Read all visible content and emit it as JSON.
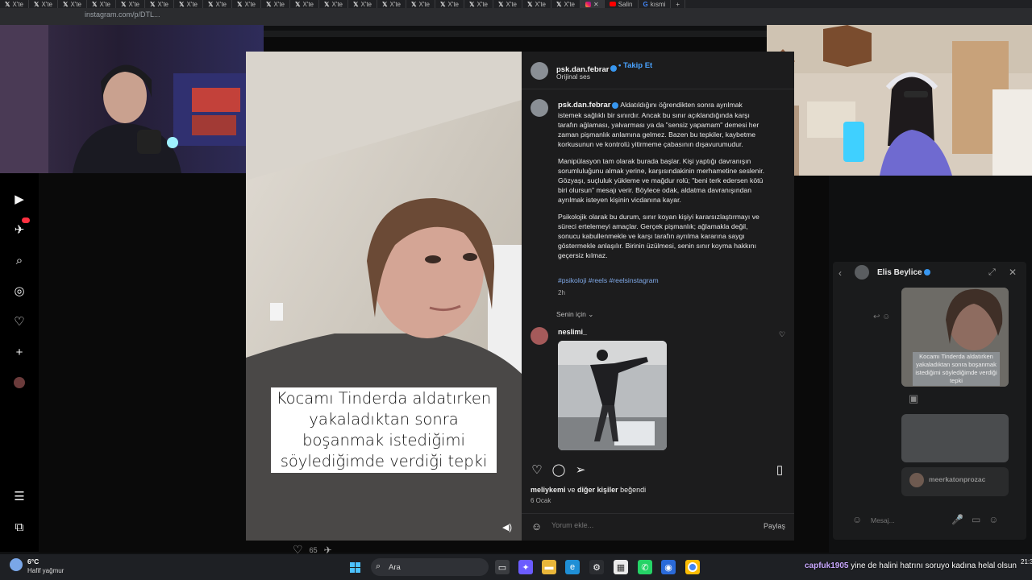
{
  "browser": {
    "tabs": [
      "X'te",
      "X'te",
      "X'te",
      "X'te",
      "X'te",
      "X'te",
      "X'te",
      "X'te",
      "X'te",
      "X'te",
      "X'te",
      "X'te",
      "X'te",
      "X'te",
      "X'te",
      "X'te",
      "X'te",
      "X'te",
      "X'te",
      "X'te",
      "Salin",
      "kısmi"
    ],
    "url": "instagram.com/p/DTL..."
  },
  "post": {
    "author": "psk.dan.febrar",
    "follow_label": "Takip Et",
    "audio": "Orijinal ses",
    "caption_author": "psk.dan.febrar",
    "caption_p1": "Aldatıldığını öğrendikten sonra ayrılmak istemek sağlıklı bir sınırdır. Ancak bu sınır açıklandığında karşı tarafın ağlaması, yalvarması ya da \"sensiz yapamam\" demesi her zaman pişmanlık anlamına gelmez. Bazen bu tepkiler, kaybetme korkusunun ve kontrolü yitirmeme çabasının dışavurumudur.",
    "caption_p2": "Manipülasyon tam olarak burada başlar. Kişi yaptığı davranışın sorumluluğunu almak yerine, karşısındakinin merhametine seslenir. Gözyaşı, suçluluk yükleme ve mağdur rolü; \"beni terk edersen kötü biri olursun\" mesajı verir. Böylece odak, aldatma davranışından ayrılmak isteyen kişinin vicdanına kayar.",
    "caption_p3": "Psikolojik olarak bu durum, sınır koyan kişiyi kararsızlaştırmayı ve süreci ertelemeyi amaçlar. Gerçek pişmanlık; ağlamakla değil, sonucu kabullenmekle ve karşı tarafın ayrılma kararına saygı göstermekle anlaşılır. Birinin üzülmesi, senin sınır koyma hakkını geçersiz kılmaz.",
    "hashtags": "#psikoloji #reels #reelsinstagram",
    "time_ago": "2h",
    "for_you": "Senin için",
    "comment_user": "neslimi_",
    "likes_user": "meliykemi",
    "likes_rest": " ve ",
    "likes_others": "diğer kişiler",
    "likes_end": " beğendi",
    "date": "6 Ocak",
    "comment_placeholder": "Yorum ekle...",
    "share_label": "Paylaş"
  },
  "video": {
    "caption": "Kocamı Tinderda aldatırken yakaladıktan sonra boşanmak istediğimi söylediğimde verdiği tepki"
  },
  "under_video": {
    "likes": "65"
  },
  "dm": {
    "name": "Elis Beylice",
    "reel_caption": "Kocamı Tinderda aldatırken yakaladıktan sonra boşanmak istediğimi söylediğimde verdiği tepki",
    "user": "meerkatonprozac",
    "input_placeholder": "Mesaj..."
  },
  "chat": {
    "user": "capfuk1905",
    "message": "yine de halini hatrını soruyo kadına helal olsun"
  },
  "taskbar": {
    "temp": "6°C",
    "weather": "Hafif yağmur",
    "search": "Ara",
    "clock": "21:3"
  },
  "colors": {
    "accent": "#4aa3ff",
    "panel_bg": "#1c1c1d",
    "verified": "#3897f0"
  }
}
